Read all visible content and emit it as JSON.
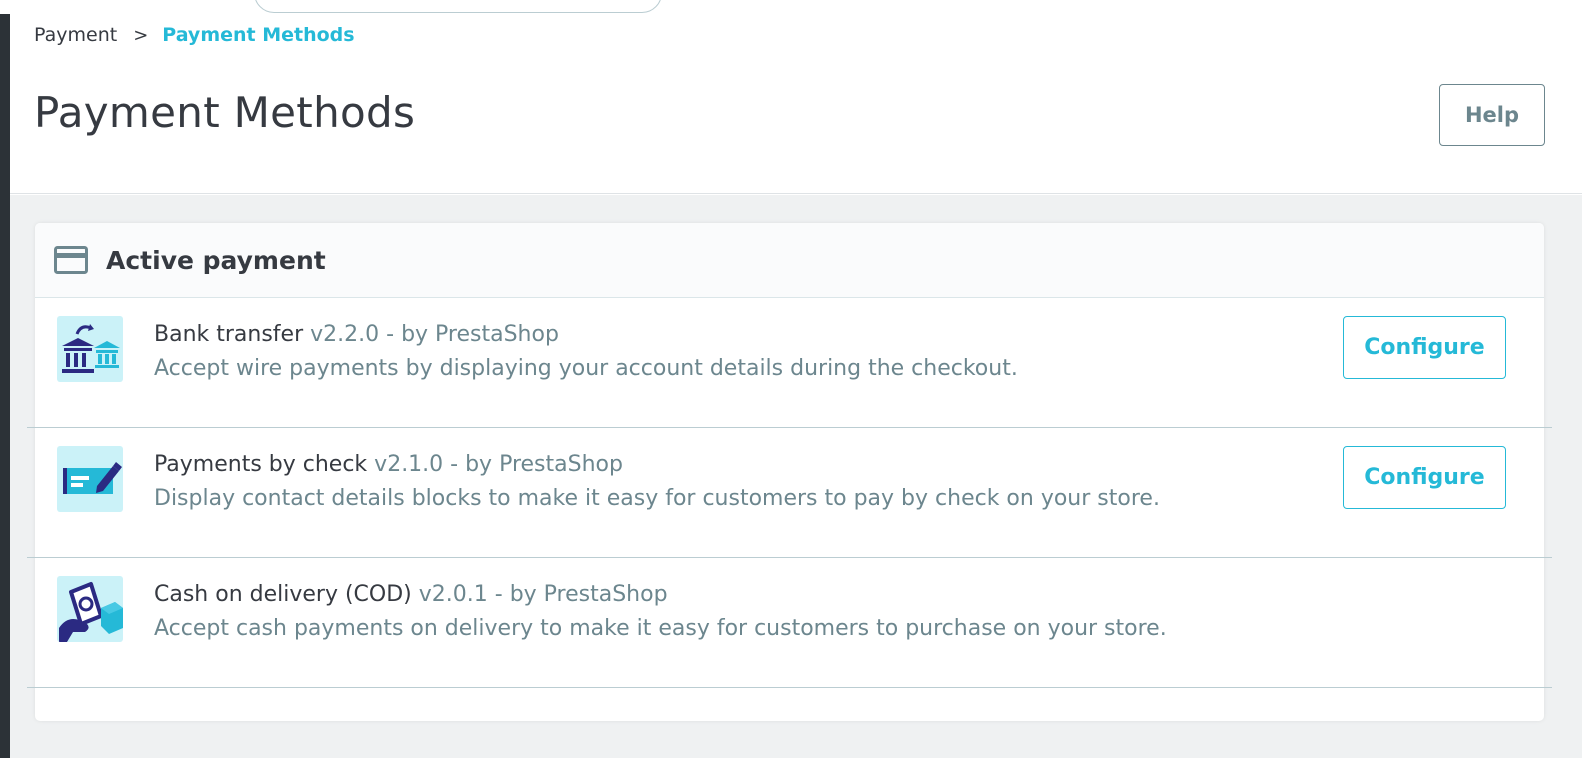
{
  "breadcrumb": {
    "parent": "Payment",
    "separator": ">",
    "current": "Payment Methods"
  },
  "page": {
    "title": "Payment Methods",
    "help_label": "Help"
  },
  "colors": {
    "accent": "#25b9d7",
    "text": "#363a41",
    "muted": "#6c868e",
    "logo_bg": "#cbf2f8",
    "logo_dark": "#2b2a82"
  },
  "active_payment": {
    "title": "Active payment",
    "icon": "credit-card-icon",
    "modules": [
      {
        "name": "Bank transfer",
        "version": "v2.2.0 - by PrestaShop",
        "description": "Accept wire payments by displaying your account details during the checkout.",
        "icon": "bank-transfer-icon",
        "configure_label": "Configure"
      },
      {
        "name": "Payments by check",
        "version": "v2.1.0 - by PrestaShop",
        "description": "Display contact details blocks to make it easy for customers to pay by check on your store.",
        "icon": "check-payment-icon",
        "configure_label": "Configure"
      },
      {
        "name": "Cash on delivery (COD)",
        "version": "v2.0.1 - by PrestaShop",
        "description": "Accept cash payments on delivery to make it easy for customers to purchase on your store.",
        "icon": "cash-on-delivery-icon"
      }
    ]
  }
}
